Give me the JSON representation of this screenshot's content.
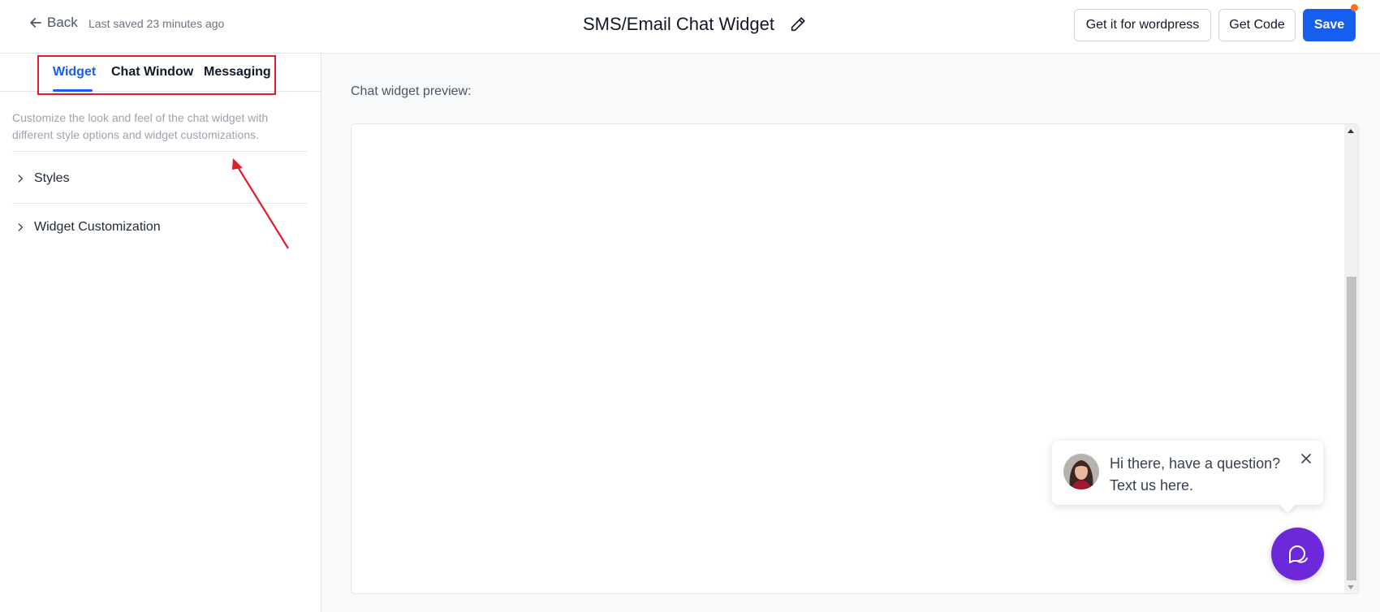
{
  "header": {
    "back_label": "Back",
    "last_saved": "Last saved 23 minutes ago",
    "title": "SMS/Email Chat Widget",
    "wordpress_button": "Get it for wordpress",
    "get_code_button": "Get Code",
    "save_button": "Save"
  },
  "tabs": [
    {
      "label": "Widget",
      "active": true
    },
    {
      "label": "Chat Window",
      "active": false
    },
    {
      "label": "Messaging",
      "active": false
    }
  ],
  "left_panel": {
    "description": "Customize the look and feel of the chat widget with different style options and widget customizations.",
    "sections": [
      {
        "label": "Styles"
      },
      {
        "label": "Widget Customization"
      }
    ]
  },
  "preview": {
    "label": "Chat widget preview:",
    "bubble_line1": "Hi there, have a question?",
    "bubble_line2": "Text us here."
  },
  "colors": {
    "accent": "#155eef",
    "launcher": "#6d28d9",
    "annotation": "#e11d2a",
    "notification": "#f97316"
  },
  "icons": [
    "arrow-left-icon",
    "pencil-icon",
    "chevron-right-icon",
    "close-icon",
    "chat-icon"
  ]
}
